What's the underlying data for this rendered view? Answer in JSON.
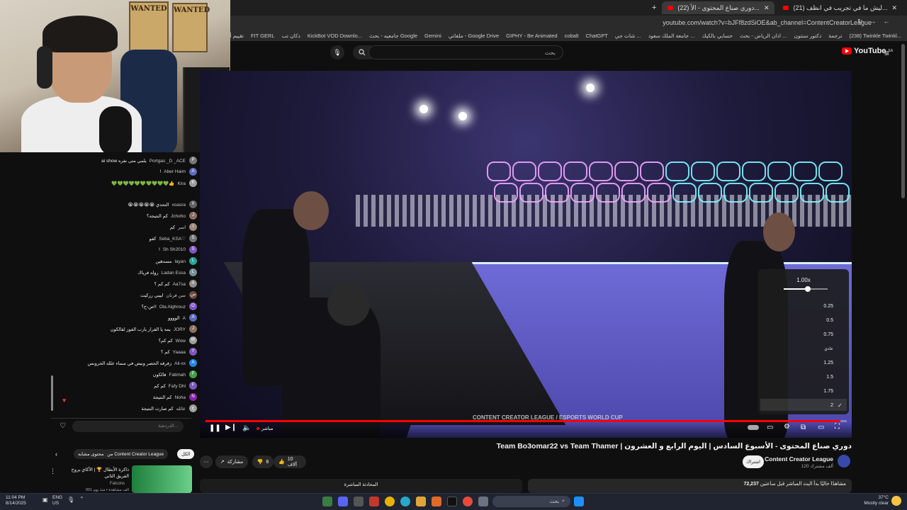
{
  "browser": {
    "tabs": [
      {
        "label": "(21) ليش ما في تجريب في انظف..."
      },
      {
        "label": "(22) دوري صناع المحتوى - الأ..."
      }
    ],
    "url": "youtube.com/watch?v=bJFf8zdSiOE&ab_channel=ContentCreatorLeague",
    "bookmarks": [
      "(238) Twinkle Twinkl...",
      "ترجمة",
      "دكتور سنتون",
      "اذان الرياض - بحث ...",
      "حسابي بالكيك",
      "جامعة الملك سعود ...",
      "شات جي ...",
      "ChatGPT",
      "cobalt",
      "GIPHY - Be Animated",
      "ملفاتي - Google Drive",
      "Gemini",
      "جامعيه - بحث Google",
      "KickBot VOD Downlo...",
      "دكان تب",
      "FIT GERL",
      "تقييم أول"
    ]
  },
  "youtube": {
    "logo_text": "YouTube",
    "logo_region": "SA",
    "search_placeholder": "بحث"
  },
  "player": {
    "progress": 0.99,
    "live_label": "مباشر",
    "speed_menu": {
      "current": "1.00x",
      "slider_fraction": 0.55,
      "options": [
        "0.25",
        "0.5",
        "0.75",
        "عادي",
        "1.25",
        "1.5",
        "1.75",
        "2"
      ],
      "checked": "2"
    },
    "overlay_text": [
      "CONTENT CREATOR LEAGUE",
      "ESPORTS WORLD CUP"
    ]
  },
  "video_meta": {
    "title": "Team Bo3omar22 vs Team Thamer | دوري صناع المحتوى - الأسبوع السادس | اليوم الرابع و العشرون",
    "channel": "Content Creator League",
    "subscribers": "120 ألف مشترك",
    "subscribe_label": "اشتراك",
    "likes": "10 آلاف",
    "dislike_count": "8",
    "share_label": "مشاركة",
    "more_label": "⋯",
    "views": "72,237",
    "description_line1": "مشاهدًا حاليًا  بدأ البث المباشر قبل ساعتين",
    "description_line2": "",
    "live_chat_label": "المحادثة المباشرة"
  },
  "chat": {
    "messages": [
      {
        "author": "Portgas _D _ACE",
        "text": "ai show يلمي متى نفره",
        "avatar_color": "#777777"
      },
      {
        "author": "Aber Haim",
        "text": "!",
        "avatar_color": "#5c6bc0"
      },
      {
        "author": "Kira",
        "text": "💚💚💚💚💚💚💚💚💚💚👍",
        "avatar_color": "#9e9e9e"
      },
      {
        "author": "xoasra",
        "text": "😭😭😭😭😭 التحدي",
        "avatar_color": "#616161"
      },
      {
        "author": "Jchoho",
        "text": "كم النتيجه؟",
        "avatar_color": "#8d6e63"
      },
      {
        "author": "اسر",
        "text": "كم",
        "avatar_color": "#a1887f"
      },
      {
        "author": "Seba_KSA♡",
        "text": "كفو",
        "avatar_color": "#757575"
      },
      {
        "author": "Sh Sh2010",
        "text": "!",
        "avatar_color": "#7e57c2"
      },
      {
        "author": "layan",
        "text": "مسدهين",
        "avatar_color": "#26a69a"
      },
      {
        "author": "Ladan Essa",
        "text": "روله فرياك",
        "avatar_color": "#78909c"
      },
      {
        "author": "Aa7sa",
        "text": "كم كم ؟",
        "avatar_color": "#8d8d8d"
      },
      {
        "author": "سن فرنان",
        "text": "اييبي رركيت",
        "avatar_color": "#6d4c41"
      },
      {
        "author": "Ola Alghrouz",
        "text": "ص-ح؟!!",
        "avatar_color": "#7e57c2"
      },
      {
        "author": "A",
        "text": "الوووو",
        "avatar_color": "#5c6bc0"
      },
      {
        "author": "JORY",
        "text": "يمه يا الفرار يارب الفوز لفالكون",
        "avatar_color": "#8d6e63"
      },
      {
        "author": "Wow",
        "text": "كم كم؟",
        "avatar_color": "#9e9e9e"
      },
      {
        "author": "Yaaaa",
        "text": "كم ؟",
        "avatar_color": "#7e57c2"
      },
      {
        "author": "Ali-xx",
        "text": "زفرقه الحصر ونيص في سماء علله الحرونس",
        "avatar_color": "#1e88e5"
      },
      {
        "author": "Fatimah",
        "text": "فالكون",
        "avatar_color": "#43a047"
      },
      {
        "author": "Fafy Dhl",
        "text": "كم كم",
        "avatar_color": "#7e57c2"
      },
      {
        "author": "Noha",
        "text": "كم النتيجة",
        "avatar_color": "#8e24aa"
      },
      {
        "author": "عائله",
        "text": "كم صارت النتيجة",
        "avatar_color": "#9e9e9e"
      }
    ],
    "input_placeholder": "الدردشة..."
  },
  "related": {
    "chips": [
      "الكل",
      "من Content Creator League",
      "محتوى مشابه"
    ],
    "item_title": "ذاكرة الأبطال 🏆 | الأكاي يروح الفريق الثاني",
    "item_channel": "Falcons",
    "item_meta": "901 ألف مشاهدة • منذ يوم"
  },
  "taskbar": {
    "search_placeholder": "بحث",
    "time": "11:04 PM",
    "date": "8/14/2025",
    "lang": "ENG",
    "region": "US",
    "weather_temp": "37°C",
    "weather_text": "Mostly clear"
  },
  "colors": {
    "accent": "#ff0000",
    "background": "#0f0f0f",
    "surface": "#272727"
  }
}
